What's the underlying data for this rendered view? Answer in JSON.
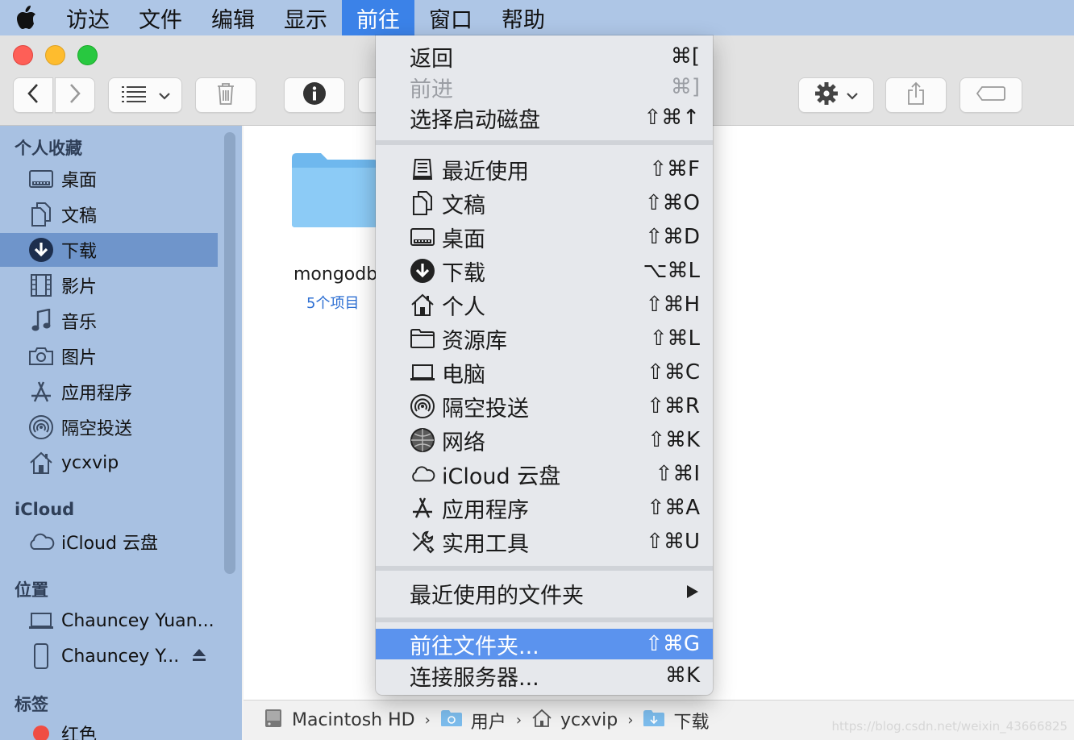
{
  "menubar": {
    "apple_icon": "apple-logo-icon",
    "menus": [
      "访达",
      "文件",
      "编辑",
      "显示",
      "前往",
      "窗口",
      "帮助"
    ],
    "active_index": 4
  },
  "toolbar": {
    "traffic_colors": [
      "#fe5f57",
      "#febc2e",
      "#28c840"
    ],
    "icons": [
      "chevron-left-icon",
      "chevron-right-icon",
      "list-view-icon",
      "trash-icon",
      "info-icon",
      "gear-icon",
      "share-icon",
      "tag-icon"
    ]
  },
  "sidebar": {
    "sections": {
      "favorites": "个人收藏",
      "icloud": "iCloud",
      "locations": "位置",
      "tags": "标签"
    },
    "favorites": [
      {
        "label": "桌面",
        "icon": "desktop-icon"
      },
      {
        "label": "文稿",
        "icon": "documents-icon"
      },
      {
        "label": "下载",
        "icon": "download-icon",
        "selected": true
      },
      {
        "label": "影片",
        "icon": "film-icon"
      },
      {
        "label": "音乐",
        "icon": "music-icon"
      },
      {
        "label": "图片",
        "icon": "camera-icon"
      },
      {
        "label": "应用程序",
        "icon": "applications-icon"
      },
      {
        "label": "隔空投送",
        "icon": "airdrop-icon"
      },
      {
        "label": "ycxvip",
        "icon": "home-icon"
      }
    ],
    "icloud": [
      {
        "label": "iCloud 云盘",
        "icon": "cloud-icon"
      }
    ],
    "locations": [
      {
        "label": "Chauncey Yuan...",
        "icon": "laptop-icon"
      },
      {
        "label": "Chauncey Y...",
        "icon": "phone-icon",
        "eject": true
      }
    ],
    "tags": [
      {
        "label": "红色",
        "color": "#f04d43"
      }
    ]
  },
  "content": {
    "folder": {
      "name": "mongodb",
      "subtitle": "5个项目",
      "color": "#6fb8ee"
    }
  },
  "pathbar": [
    {
      "label": "Macintosh HD",
      "icon": "hard-drive-icon"
    },
    {
      "label": "用户",
      "icon": "folder-icon"
    },
    {
      "label": "ycxvip",
      "icon": "home-icon"
    },
    {
      "label": "下载",
      "icon": "folder-icon"
    }
  ],
  "go_menu": {
    "group1": [
      {
        "label": "返回",
        "shortcut": "⌘[",
        "disabled": false
      },
      {
        "label": "前进",
        "shortcut": "⌘]",
        "disabled": true
      },
      {
        "label": "选择启动磁盘",
        "shortcut": "⇧⌘↑",
        "disabled": false
      }
    ],
    "group2": [
      {
        "label": "最近使用",
        "shortcut": "⇧⌘F",
        "icon": "recents-icon"
      },
      {
        "label": "文稿",
        "shortcut": "⇧⌘O",
        "icon": "documents-icon"
      },
      {
        "label": "桌面",
        "shortcut": "⇧⌘D",
        "icon": "desktop-icon"
      },
      {
        "label": "下载",
        "shortcut": "⌥⌘L",
        "icon": "download-icon"
      },
      {
        "label": "个人",
        "shortcut": "⇧⌘H",
        "icon": "home-icon"
      },
      {
        "label": "资源库",
        "shortcut": "⇧⌘L",
        "icon": "folder-icon"
      },
      {
        "label": "电脑",
        "shortcut": "⇧⌘C",
        "icon": "computer-icon"
      },
      {
        "label": "隔空投送",
        "shortcut": "⇧⌘R",
        "icon": "airdrop-icon"
      },
      {
        "label": "网络",
        "shortcut": "⇧⌘K",
        "icon": "network-icon"
      },
      {
        "label": "iCloud 云盘",
        "shortcut": "⇧⌘I",
        "icon": "cloud-icon"
      },
      {
        "label": "应用程序",
        "shortcut": "⇧⌘A",
        "icon": "applications-icon"
      },
      {
        "label": "实用工具",
        "shortcut": "⇧⌘U",
        "icon": "utilities-icon"
      }
    ],
    "recent_folders": {
      "label": "最近使用的文件夹",
      "submenu_icon": "triangle-right-icon"
    },
    "group4": [
      {
        "label": "前往文件夹...",
        "shortcut": "⇧⌘G",
        "highlighted": true
      },
      {
        "label": "连接服务器...",
        "shortcut": "⌘K",
        "highlighted": false
      }
    ]
  },
  "watermark": "https://blog.csdn.net/weixin_43666825"
}
